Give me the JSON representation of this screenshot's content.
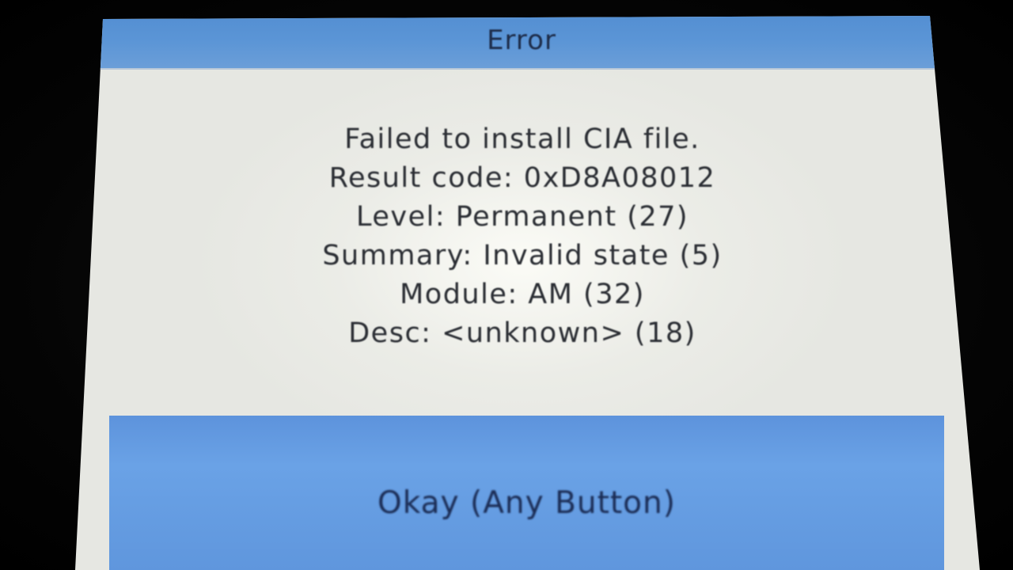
{
  "dialog": {
    "title": "Error",
    "lines": [
      "Failed to install CIA file.",
      "Result code: 0xD8A08012",
      "Level: Permanent (27)",
      "Summary: Invalid state (5)",
      "Module: AM (32)",
      "Desc: <unknown> (18)"
    ],
    "button_label": "Okay (Any Button)"
  },
  "colors": {
    "title_bar": "#5b95d6",
    "button": "#6aa2e6",
    "screen_background": "#e6e7e2",
    "text": "#2a2d33"
  }
}
